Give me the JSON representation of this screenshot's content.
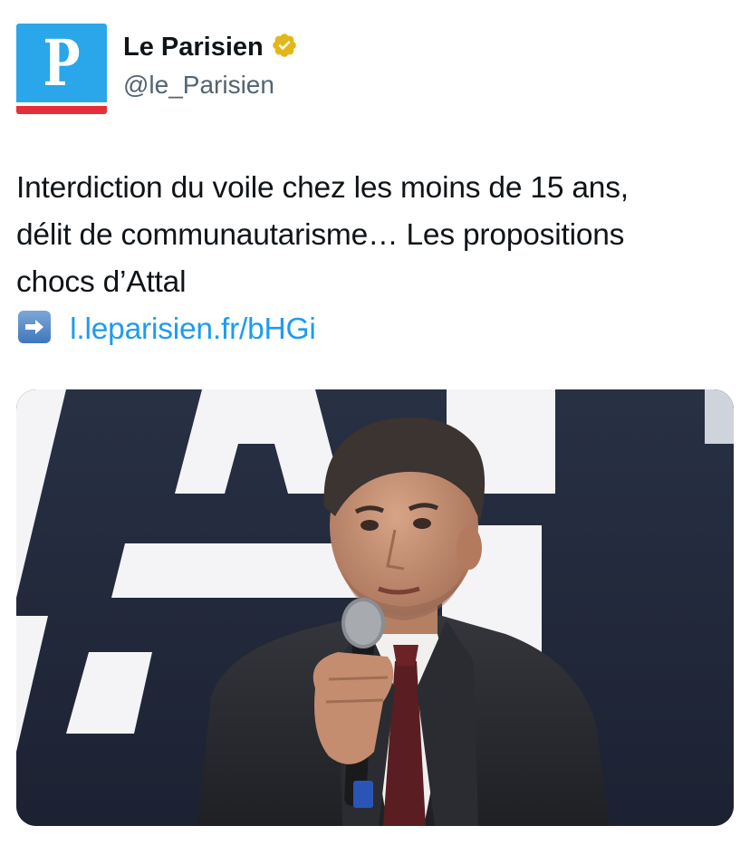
{
  "account": {
    "display_name": "Le Parisien",
    "handle": "@le_Parisien",
    "avatar_letter": "P",
    "verified": true,
    "avatar_colors": {
      "blue": "#2aa6ea",
      "red": "#e42f3a"
    },
    "verified_badge_color": "#e2b719"
  },
  "tweet": {
    "text_lines": [
      "Interdiction du voile chez les moins de 15 ans,",
      "délit de communautarisme… Les propositions",
      "chocs d’Attal"
    ],
    "link_icon": "right-arrow-emoji-icon",
    "link_text": "l.leparisien.fr/bHGi",
    "link_color": "#1d9bf0"
  },
  "media": {
    "background_letters": "AI"
  }
}
